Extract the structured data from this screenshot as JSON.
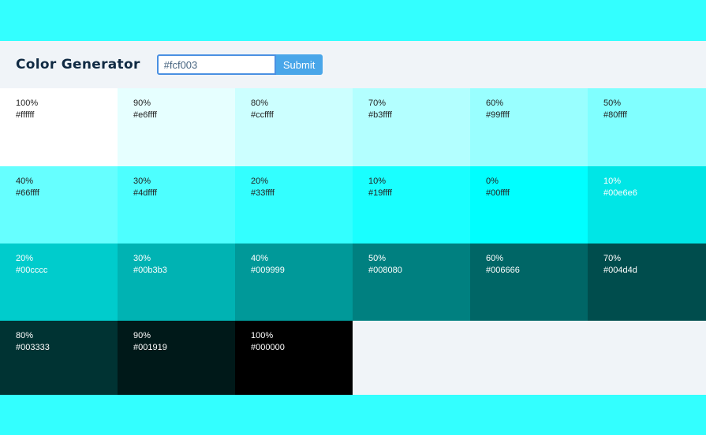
{
  "app": {
    "title": "Color Generator"
  },
  "form": {
    "input_value": "#fcf003",
    "submit_label": "Submit"
  },
  "swatches": [
    {
      "percent": "100%",
      "hex": "#ffffff",
      "color": "#ffffff",
      "text": "dark"
    },
    {
      "percent": "90%",
      "hex": "#e6ffff",
      "color": "#e6ffff",
      "text": "dark"
    },
    {
      "percent": "80%",
      "hex": "#ccffff",
      "color": "#ccffff",
      "text": "dark"
    },
    {
      "percent": "70%",
      "hex": "#b3ffff",
      "color": "#b3ffff",
      "text": "dark"
    },
    {
      "percent": "60%",
      "hex": "#99ffff",
      "color": "#99ffff",
      "text": "dark"
    },
    {
      "percent": "50%",
      "hex": "#80ffff",
      "color": "#80ffff",
      "text": "dark"
    },
    {
      "percent": "40%",
      "hex": "#66ffff",
      "color": "#66ffff",
      "text": "dark"
    },
    {
      "percent": "30%",
      "hex": "#4dffff",
      "color": "#4dffff",
      "text": "dark"
    },
    {
      "percent": "20%",
      "hex": "#33ffff",
      "color": "#33ffff",
      "text": "dark"
    },
    {
      "percent": "10%",
      "hex": "#19ffff",
      "color": "#19ffff",
      "text": "dark"
    },
    {
      "percent": "0%",
      "hex": "#00ffff",
      "color": "#00ffff",
      "text": "dark"
    },
    {
      "percent": "10%",
      "hex": "#00e6e6",
      "color": "#00e6e6",
      "text": "light"
    },
    {
      "percent": "20%",
      "hex": "#00cccc",
      "color": "#00cccc",
      "text": "light"
    },
    {
      "percent": "30%",
      "hex": "#00b3b3",
      "color": "#00b3b3",
      "text": "light"
    },
    {
      "percent": "40%",
      "hex": "#009999",
      "color": "#009999",
      "text": "light"
    },
    {
      "percent": "50%",
      "hex": "#008080",
      "color": "#008080",
      "text": "light"
    },
    {
      "percent": "60%",
      "hex": "#006666",
      "color": "#006666",
      "text": "light"
    },
    {
      "percent": "70%",
      "hex": "#004d4d",
      "color": "#004d4d",
      "text": "light"
    },
    {
      "percent": "80%",
      "hex": "#003333",
      "color": "#003333",
      "text": "light"
    },
    {
      "percent": "90%",
      "hex": "#001919",
      "color": "#001919",
      "text": "light"
    },
    {
      "percent": "100%",
      "hex": "#000000",
      "color": "#000000",
      "text": "light"
    }
  ],
  "colors": {
    "page_background": "#33ffff",
    "panel_background": "#f0f4f8",
    "title": "#102a43",
    "input_border": "#4a90e2",
    "submit_background": "#49a6e9"
  }
}
